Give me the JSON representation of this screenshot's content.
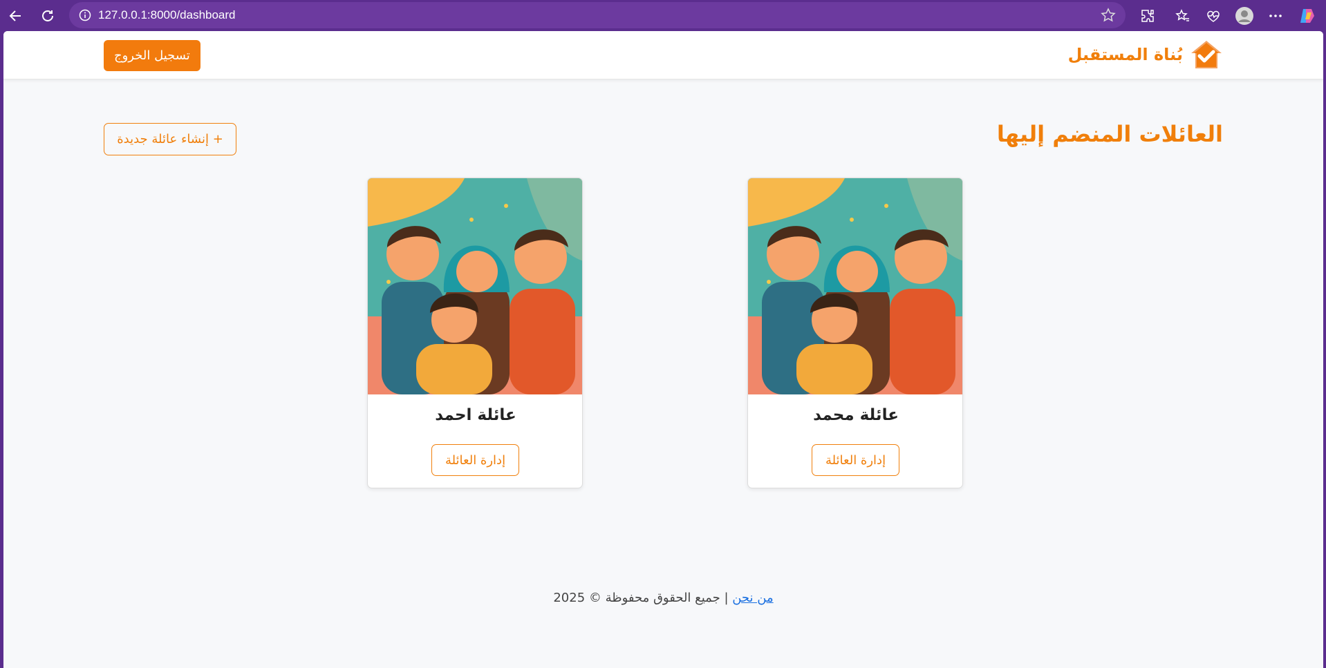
{
  "browser": {
    "url": "127.0.0.1:8000/dashboard"
  },
  "header": {
    "brand_name": "بُناة المستقبل",
    "logout_label": "تسجيل الخروج"
  },
  "main": {
    "title": "العائلات المنضم إليها",
    "create_label": "+ إنشاء عائلة جديدة",
    "families": [
      {
        "name": "عائلة محمد",
        "manage_label": "إدارة العائلة"
      },
      {
        "name": "عائلة احمد",
        "manage_label": "إدارة العائلة"
      }
    ]
  },
  "footer": {
    "about_link": "من نحن",
    "separator": " | ",
    "rights_text": "جميع الحقوق محفوظة © 2025"
  },
  "colors": {
    "browser_frame": "#5b2d8e",
    "accent": "#f07f0b",
    "page_bg": "#f7f8fa",
    "link": "#1a6fe0"
  }
}
